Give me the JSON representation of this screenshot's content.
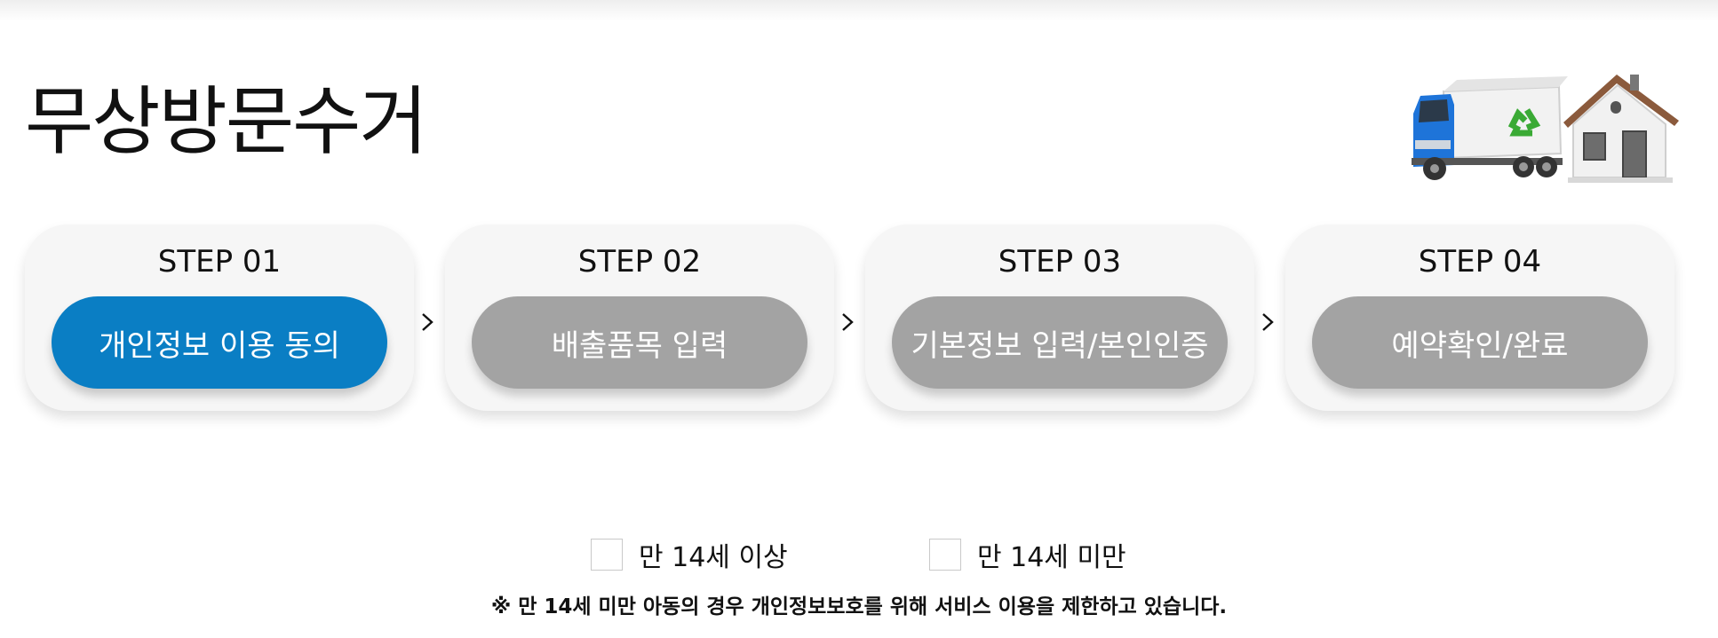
{
  "page": {
    "title": "무상방문수거"
  },
  "hero": {
    "icon": "truck-recycle-house-illustration",
    "colors": {
      "truck": "#1e74d9",
      "recycle": "#3aaa35",
      "roof": "#8b5a3c"
    }
  },
  "steps": [
    {
      "title": "STEP 01",
      "label": "개인정보 이용 동의",
      "active": true
    },
    {
      "title": "STEP 02",
      "label": "배출품목 입력",
      "active": false
    },
    {
      "title": "STEP 03",
      "label": "기본정보 입력/본인인증",
      "active": false
    },
    {
      "title": "STEP 04",
      "label": "예약확인/완료",
      "active": false
    }
  ],
  "colors": {
    "active_step": "#0a7ec4",
    "inactive_step": "#a3a3a3",
    "card_bg": "#f6f6f6"
  },
  "age": {
    "options": [
      {
        "label": "만 14세 이상",
        "checked": false
      },
      {
        "label": "만 14세 미만",
        "checked": false
      }
    ],
    "notice": "※ 만 14세 미만 아동의 경우 개인정보보호를 위해 서비스 이용을 제한하고 있습니다."
  }
}
